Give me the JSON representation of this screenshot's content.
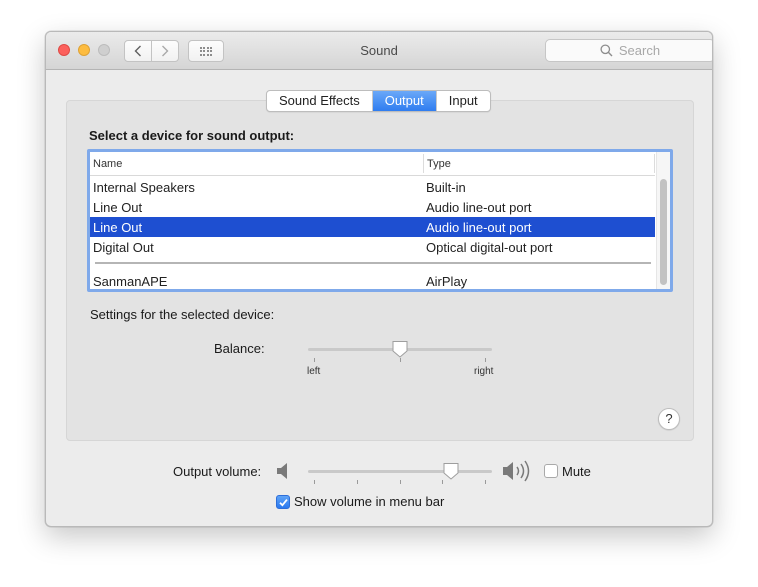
{
  "window": {
    "title": "Sound",
    "search_placeholder": "Search"
  },
  "tabs": [
    {
      "label": "Sound Effects",
      "active": false
    },
    {
      "label": "Output",
      "active": true
    },
    {
      "label": "Input",
      "active": false
    }
  ],
  "output": {
    "heading": "Select a device for sound output:",
    "columns": {
      "name": "Name",
      "type": "Type"
    },
    "devices": [
      {
        "name": "Internal Speakers",
        "type": "Built-in",
        "selected": false
      },
      {
        "name": "Line Out",
        "type": "Audio line-out port",
        "selected": false
      },
      {
        "name": "Line Out",
        "type": "Audio line-out port",
        "selected": true
      },
      {
        "name": "Digital Out",
        "type": "Optical digital-out port",
        "selected": false
      },
      {
        "name": "SanmanAPE",
        "type": "AirPlay",
        "selected": false
      }
    ],
    "settings_label": "Settings for the selected device:",
    "balance": {
      "label": "Balance:",
      "left_label": "left",
      "right_label": "right",
      "value": 0.5
    },
    "help_label": "?"
  },
  "footer": {
    "volume_label": "Output volume:",
    "volume_value": 0.8,
    "mute_label": "Mute",
    "mute_checked": false,
    "show_volume_label": "Show volume in menu bar",
    "show_volume_checked": true
  },
  "colors": {
    "selection": "#1e4fd1",
    "tab_active": "#2f7df0",
    "list_focus_ring": "#7fa9ea"
  }
}
